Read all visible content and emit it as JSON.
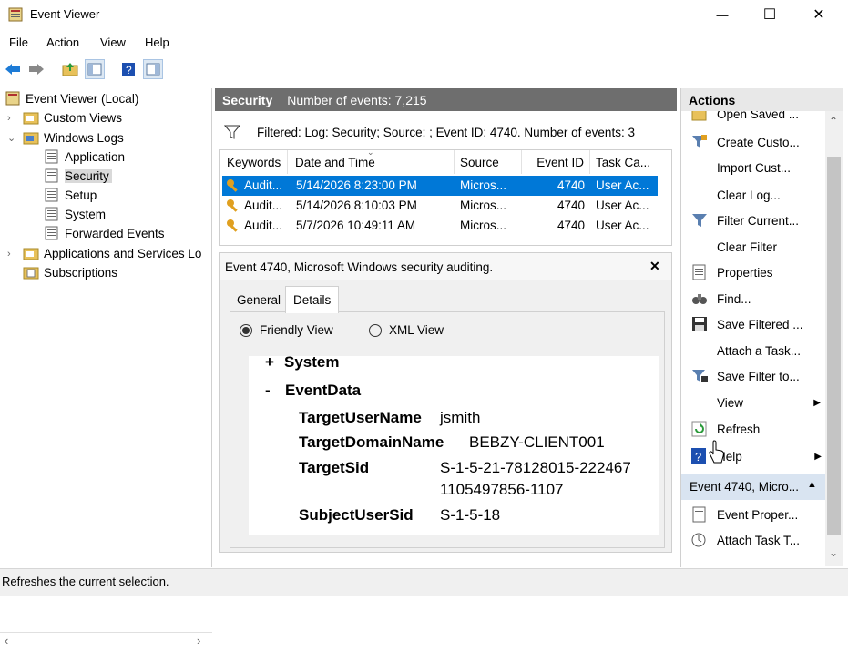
{
  "window": {
    "title": "Event Viewer",
    "minimize": "—",
    "maximize": "☐",
    "close": "✕"
  },
  "menu": [
    "File",
    "Action",
    "View",
    "Help"
  ],
  "tree": {
    "root": "Event Viewer (Local)",
    "custom_views": "Custom Views",
    "windows_logs": "Windows Logs",
    "application": "Application",
    "security": "Security",
    "setup": "Setup",
    "system": "System",
    "forwarded": "Forwarded Events",
    "apps_services": "Applications and Services Lo",
    "subscriptions": "Subscriptions"
  },
  "middle": {
    "log_name": "Security",
    "count_label": "Number of events: 7,215"
  },
  "filter": {
    "text": "Filtered: Log: Security; Source: ; Event ID: 4740. Number of events: 3"
  },
  "grid": {
    "headers": [
      "Keywords",
      "Date and Time",
      "Source",
      "Event ID",
      "Task Ca..."
    ],
    "rows": [
      {
        "keywords": "Audit...",
        "date": "5/14/2026 8:23:00 PM",
        "source": "Micros...",
        "event_id": "4740",
        "task": "User Ac..."
      },
      {
        "keywords": "Audit...",
        "date": "5/14/2026 8:10:03 PM",
        "source": "Micros...",
        "event_id": "4740",
        "task": "User Ac..."
      },
      {
        "keywords": "Audit...",
        "date": "5/7/2026 10:49:11 AM",
        "source": "Micros...",
        "event_id": "4740",
        "task": "User Ac..."
      }
    ]
  },
  "detail": {
    "header": "Event 4740, Microsoft Windows security auditing.",
    "close": "✕",
    "tabs": [
      "General",
      "Details"
    ],
    "friendly_view": "Friendly View",
    "xml_view": "XML View",
    "system_toggle": "+",
    "system_label": "System",
    "eventdata_toggle": "-",
    "eventdata_label": "EventData",
    "fields": [
      {
        "key": "TargetUserName",
        "value": "jsmith"
      },
      {
        "key": "TargetDomainName",
        "value": "BEBZY-CLIENT001"
      },
      {
        "key": "TargetSid",
        "value": "S-1-5-21-78128015-222467",
        "value2": "1105497856-1107"
      },
      {
        "key": "SubjectUserSid",
        "value": "S-1-5-18"
      }
    ]
  },
  "actions": {
    "header": "Actions",
    "items": [
      "Open Saved ...",
      "Create Custo...",
      "Import Cust...",
      "Clear Log...",
      "Filter Current...",
      "Clear Filter",
      "Properties",
      "Find...",
      "Save Filtered ...",
      "Attach a Task...",
      "Save Filter to...",
      "View",
      "Refresh",
      "Help"
    ],
    "section2": "Event 4740, Micro...",
    "items2": [
      "Event Proper...",
      "Attach Task T..."
    ]
  },
  "status": "Refreshes the current selection.",
  "colors": {
    "selection": "#0078d7",
    "header_gray": "#6e6e6e"
  }
}
